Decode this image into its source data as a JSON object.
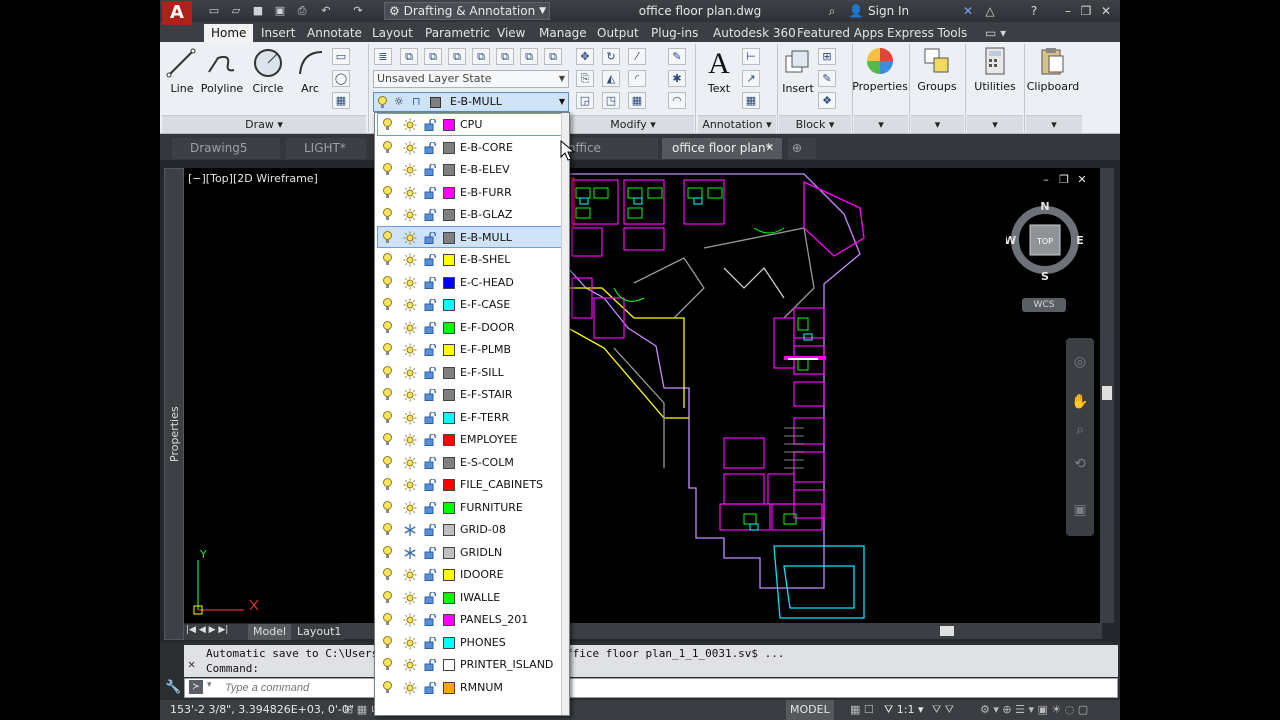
{
  "title_bar": {
    "workspace": "Drafting & Annotation",
    "document_title": "office floor plan.dwg",
    "signin": "Sign In"
  },
  "ribbon_tabs": [
    "Home",
    "Insert",
    "Annotate",
    "Layout",
    "Parametric",
    "View",
    "Manage",
    "Output",
    "Plug-ins",
    "Autodesk 360",
    "Featured Apps",
    "Express Tools"
  ],
  "ribbon": {
    "draw_tools": [
      "Line",
      "Polyline",
      "Circle",
      "Arc"
    ],
    "panels": {
      "draw": "Draw",
      "modify": "Modify",
      "annotation": "Annotation",
      "block": "Block"
    },
    "text_label": "Text",
    "insert_label": "Insert",
    "big_buttons": [
      "Properties",
      "Groups",
      "Utilities",
      "Clipboard"
    ],
    "layer_state": "Unsaved Layer State",
    "current_layer": "E-B-MULL"
  },
  "file_tabs": [
    "Drawing5",
    "LIGHT*",
    "office",
    "office floor plan*"
  ],
  "viewport": {
    "label": "[−][Top][2D Wireframe]",
    "properties_label": "Properties",
    "viewcube": {
      "n": "N",
      "s": "S",
      "e": "E",
      "w": "W",
      "top": "TOP",
      "wcs": "WCS"
    }
  },
  "model_tabs": [
    "Model",
    "Layout1"
  ],
  "command": {
    "history_line1": "Automatic save to C:\\Users",
    "history_line1_end": "ffice floor plan_1_1_0031.sv$ ...",
    "history_line2": "Command:",
    "placeholder": "Type a command"
  },
  "status": {
    "coords": "153'-2 3/8\", 3.394826E+03, 0'-0\"",
    "model": "MODEL",
    "scale": "1:1"
  },
  "layers": [
    {
      "name": "CPU",
      "color": "#ff00ff"
    },
    {
      "name": "E-B-CORE",
      "color": "#808080"
    },
    {
      "name": "E-B-ELEV",
      "color": "#808080"
    },
    {
      "name": "E-B-FURR",
      "color": "#ff00ff"
    },
    {
      "name": "E-B-GLAZ",
      "color": "#808080"
    },
    {
      "name": "E-B-MULL",
      "color": "#808080"
    },
    {
      "name": "E-B-SHEL",
      "color": "#ffff00"
    },
    {
      "name": "E-C-HEAD",
      "color": "#0000ff"
    },
    {
      "name": "E-F-CASE",
      "color": "#00ffff"
    },
    {
      "name": "E-F-DOOR",
      "color": "#00ff00"
    },
    {
      "name": "E-F-PLMB",
      "color": "#ffff00"
    },
    {
      "name": "E-F-SILL",
      "color": "#808080"
    },
    {
      "name": "E-F-STAIR",
      "color": "#808080"
    },
    {
      "name": "E-F-TERR",
      "color": "#00ffff"
    },
    {
      "name": "EMPLOYEE",
      "color": "#ff0000"
    },
    {
      "name": "E-S-COLM",
      "color": "#808080"
    },
    {
      "name": "FILE_CABINETS",
      "color": "#ff0000"
    },
    {
      "name": "FURNITURE",
      "color": "#00ff00"
    },
    {
      "name": "GRID-08",
      "color": "#c0c0c0"
    },
    {
      "name": "GRIDLN",
      "color": "#c0c0c0"
    },
    {
      "name": "IDOORE",
      "color": "#ffff00"
    },
    {
      "name": "IWALLE",
      "color": "#00ff00"
    },
    {
      "name": "PANELS_201",
      "color": "#ff00ff"
    },
    {
      "name": "PHONES",
      "color": "#00ffff"
    },
    {
      "name": "PRINTER_ISLAND",
      "color": "#ffffff"
    },
    {
      "name": "RMNUM",
      "color": "#ffa500"
    }
  ]
}
